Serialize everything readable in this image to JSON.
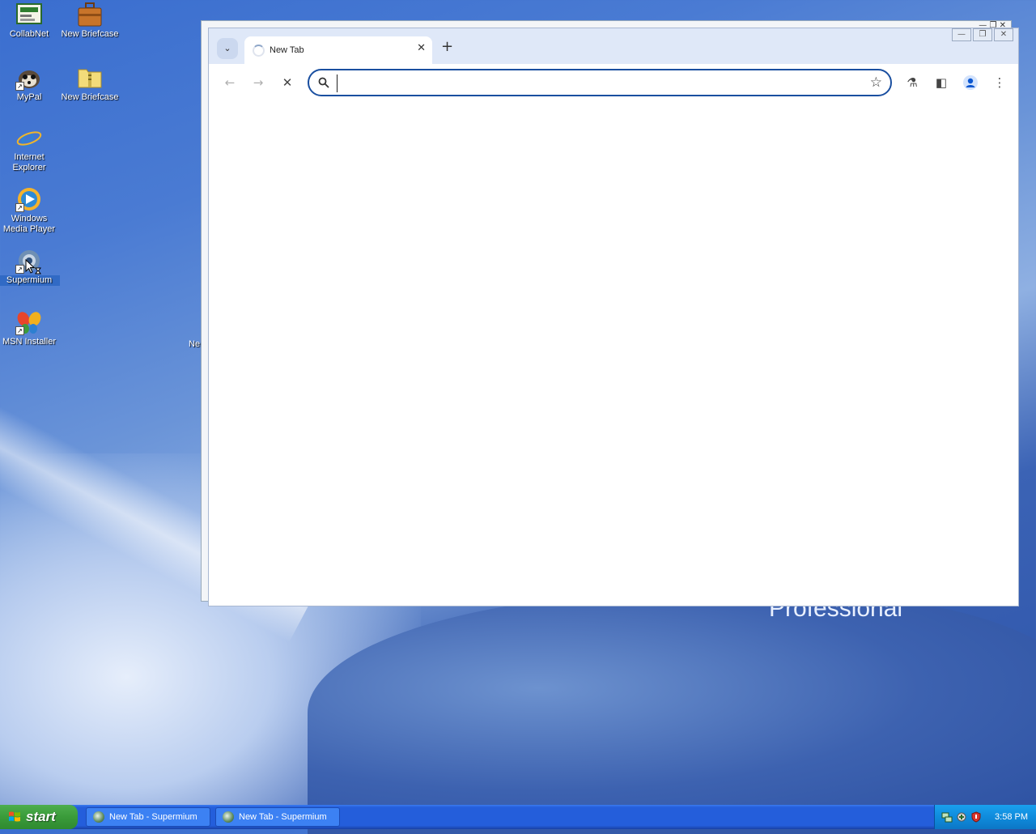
{
  "desktop": {
    "icons": [
      {
        "label": "CollabNet"
      },
      {
        "label": "New Briefcase"
      },
      {
        "label": "MyPal"
      },
      {
        "label": "New Briefcase"
      },
      {
        "label": "Internet Explorer"
      },
      {
        "label": "Windows Media Player"
      },
      {
        "label": "Supermium"
      },
      {
        "label": "MSN Installer"
      }
    ],
    "wallpaper_text": "Professional",
    "clipped_label": "Ne"
  },
  "browser": {
    "tab": {
      "title": "New Tab",
      "close": "✕"
    },
    "new_tab_icon": "+",
    "tab_search_icon": "⌄",
    "window_controls": {
      "minimize": "—",
      "maximize": "❐",
      "close": "✕"
    },
    "toolbar": {
      "back": "←",
      "forward": "→",
      "stop": "✕",
      "bookmark_icon": "☆",
      "labs_icon": "⚗",
      "side_panel_icon": "◧",
      "profile_icon": "profile-icon",
      "menu_icon": "⋮"
    },
    "omnibox": {
      "value": "",
      "placeholder": ""
    }
  },
  "taskbar": {
    "start_label": "start",
    "buttons": [
      {
        "label": "New Tab - Supermium"
      },
      {
        "label": "New Tab - Supermium"
      }
    ],
    "clock": "3:58 PM"
  },
  "colors": {
    "accent": "#1a4fa0",
    "taskbar": "#245edb",
    "start_green": "#3a9b3a"
  }
}
